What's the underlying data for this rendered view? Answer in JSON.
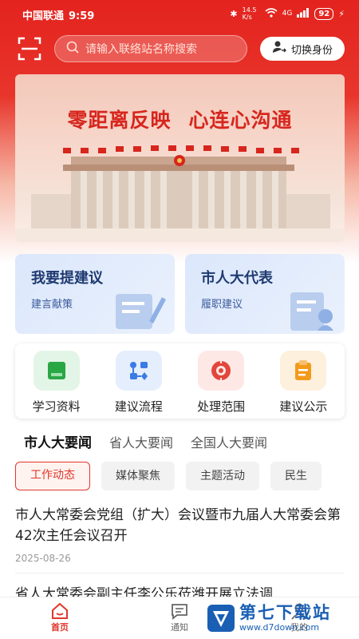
{
  "status_bar": {
    "carrier": "中国联通",
    "time": "9:59",
    "network_speed": "14.5 K/s",
    "signal": "4G",
    "battery": "92"
  },
  "top_bar": {
    "search_placeholder": "请输入联络站名称搜索",
    "switch_identity_label": "切换身份"
  },
  "banner": {
    "slogan_part1": "零距离反映",
    "slogan_part2": "心连心沟通"
  },
  "cards": [
    {
      "title": "我要提建议",
      "subtitle": "建言献策"
    },
    {
      "title": "市人大代表",
      "subtitle": "履职建议"
    }
  ],
  "quick_links": [
    {
      "label": "学习资料",
      "icon": "book-icon",
      "color": "#2aa745",
      "bg": "#e3f5e6"
    },
    {
      "label": "建议流程",
      "icon": "flow-icon",
      "color": "#3a7be6",
      "bg": "#e5eefc"
    },
    {
      "label": "处理范围",
      "icon": "target-icon",
      "color": "#e2453a",
      "bg": "#fde8e6"
    },
    {
      "label": "建议公示",
      "icon": "clipboard-icon",
      "color": "#f39a1b",
      "bg": "#fdf0dd"
    }
  ],
  "news_tabs": [
    "市人大要闻",
    "省人大要闻",
    "全国人大要闻"
  ],
  "news_tab_active": 0,
  "chips": [
    "工作动态",
    "媒体聚焦",
    "主题活动",
    "民生"
  ],
  "articles": [
    {
      "title": "市人大常委会党组（扩大）会议暨市九届人大常委会第42次主任会议召开",
      "date": "2025-08-26"
    },
    {
      "title": "省人大常委会副主任李公乐莅潍开展立法调",
      "date": ""
    }
  ],
  "bottom_nav": [
    {
      "label": "首页",
      "icon": "home-icon",
      "active": true
    },
    {
      "label": "通知",
      "icon": "message-icon",
      "active": false
    },
    {
      "label": "我的",
      "icon": "user-icon",
      "active": false
    }
  ],
  "watermark": {
    "text": "第七下载站",
    "url": "www.d7down.com"
  },
  "colors": {
    "brand_red": "#e3231e",
    "accent": "#e0372c",
    "card_title": "#1f3a70"
  }
}
